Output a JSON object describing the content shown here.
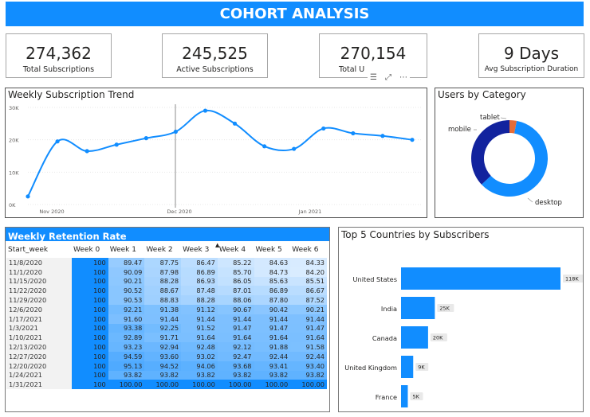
{
  "title": "COHORT ANALYSIS",
  "kpis": [
    {
      "value": "274,362",
      "label": "Total Subscriptions"
    },
    {
      "value": "245,525",
      "label": "Active Subscriptions"
    },
    {
      "value": "270,154",
      "label": "Total U"
    },
    {
      "value": "9 Days",
      "label": "Avg Subscription Duration"
    }
  ],
  "trend": {
    "title": "Weekly Subscription Trend",
    "chart_data": {
      "type": "line",
      "y_ticks": [
        "30K",
        "20K",
        "10K",
        "0K"
      ],
      "x_ticks": [
        "Nov 2020",
        "Dec 2020",
        "Jan 2021"
      ],
      "ylim": [
        0,
        30000
      ],
      "values": [
        2500,
        19500,
        16500,
        18500,
        20500,
        22500,
        29000,
        25000,
        18000,
        17200,
        23500,
        22000,
        21200,
        20000
      ]
    }
  },
  "category": {
    "title": "Users by Category",
    "chart_data": {
      "type": "pie",
      "labels": [
        "desktop",
        "mobile",
        "tablet"
      ],
      "values": [
        60,
        37,
        3
      ],
      "colors": [
        "#118dff",
        "#12239e",
        "#e66c37"
      ]
    }
  },
  "retention": {
    "title": "Weekly Retention Rate",
    "columns": [
      "Start_week",
      "Week 0",
      "Week 1",
      "Week 2",
      "Week 3",
      "Week 4",
      "Week 5",
      "Week 6"
    ],
    "rows": [
      [
        "11/8/2020",
        "100",
        "89.47",
        "87.75",
        "86.47",
        "85.22",
        "84.63",
        "84.33"
      ],
      [
        "11/1/2020",
        "100",
        "90.09",
        "87.98",
        "86.89",
        "85.70",
        "84.73",
        "84.20"
      ],
      [
        "11/15/2020",
        "100",
        "90.21",
        "88.28",
        "86.93",
        "86.05",
        "85.63",
        "85.51"
      ],
      [
        "11/22/2020",
        "100",
        "90.52",
        "88.67",
        "87.48",
        "87.01",
        "86.89",
        "86.67"
      ],
      [
        "11/29/2020",
        "100",
        "90.53",
        "88.83",
        "88.28",
        "88.06",
        "87.80",
        "87.52"
      ],
      [
        "12/6/2020",
        "100",
        "92.21",
        "91.38",
        "91.12",
        "90.67",
        "90.42",
        "90.21"
      ],
      [
        "1/17/2021",
        "100",
        "91.60",
        "91.44",
        "91.44",
        "91.44",
        "91.44",
        "91.44"
      ],
      [
        "1/3/2021",
        "100",
        "93.38",
        "92.25",
        "91.52",
        "91.47",
        "91.47",
        "91.47"
      ],
      [
        "1/10/2021",
        "100",
        "92.89",
        "91.71",
        "91.64",
        "91.64",
        "91.64",
        "91.64"
      ],
      [
        "12/13/2020",
        "100",
        "93.23",
        "92.94",
        "92.48",
        "92.12",
        "91.88",
        "91.58"
      ],
      [
        "12/27/2020",
        "100",
        "94.59",
        "93.60",
        "93.02",
        "92.47",
        "92.44",
        "92.44"
      ],
      [
        "12/20/2020",
        "100",
        "95.13",
        "94.52",
        "94.06",
        "93.68",
        "93.41",
        "93.40"
      ],
      [
        "1/24/2021",
        "100",
        "93.82",
        "93.82",
        "93.82",
        "93.82",
        "93.82",
        "93.82"
      ],
      [
        "1/31/2021",
        "100",
        "100.00",
        "100.00",
        "100.00",
        "100.00",
        "100.00",
        "100.00"
      ]
    ]
  },
  "countries": {
    "title": "Top 5 Countries by Subscribers",
    "chart_data": {
      "type": "bar",
      "categories": [
        "United States",
        "India",
        "Canada",
        "United Kingdom",
        "France"
      ],
      "values": [
        118000,
        25000,
        20000,
        9000,
        5000
      ],
      "labels": [
        "118K",
        "25K",
        "20K",
        "9K",
        "5K"
      ]
    }
  }
}
